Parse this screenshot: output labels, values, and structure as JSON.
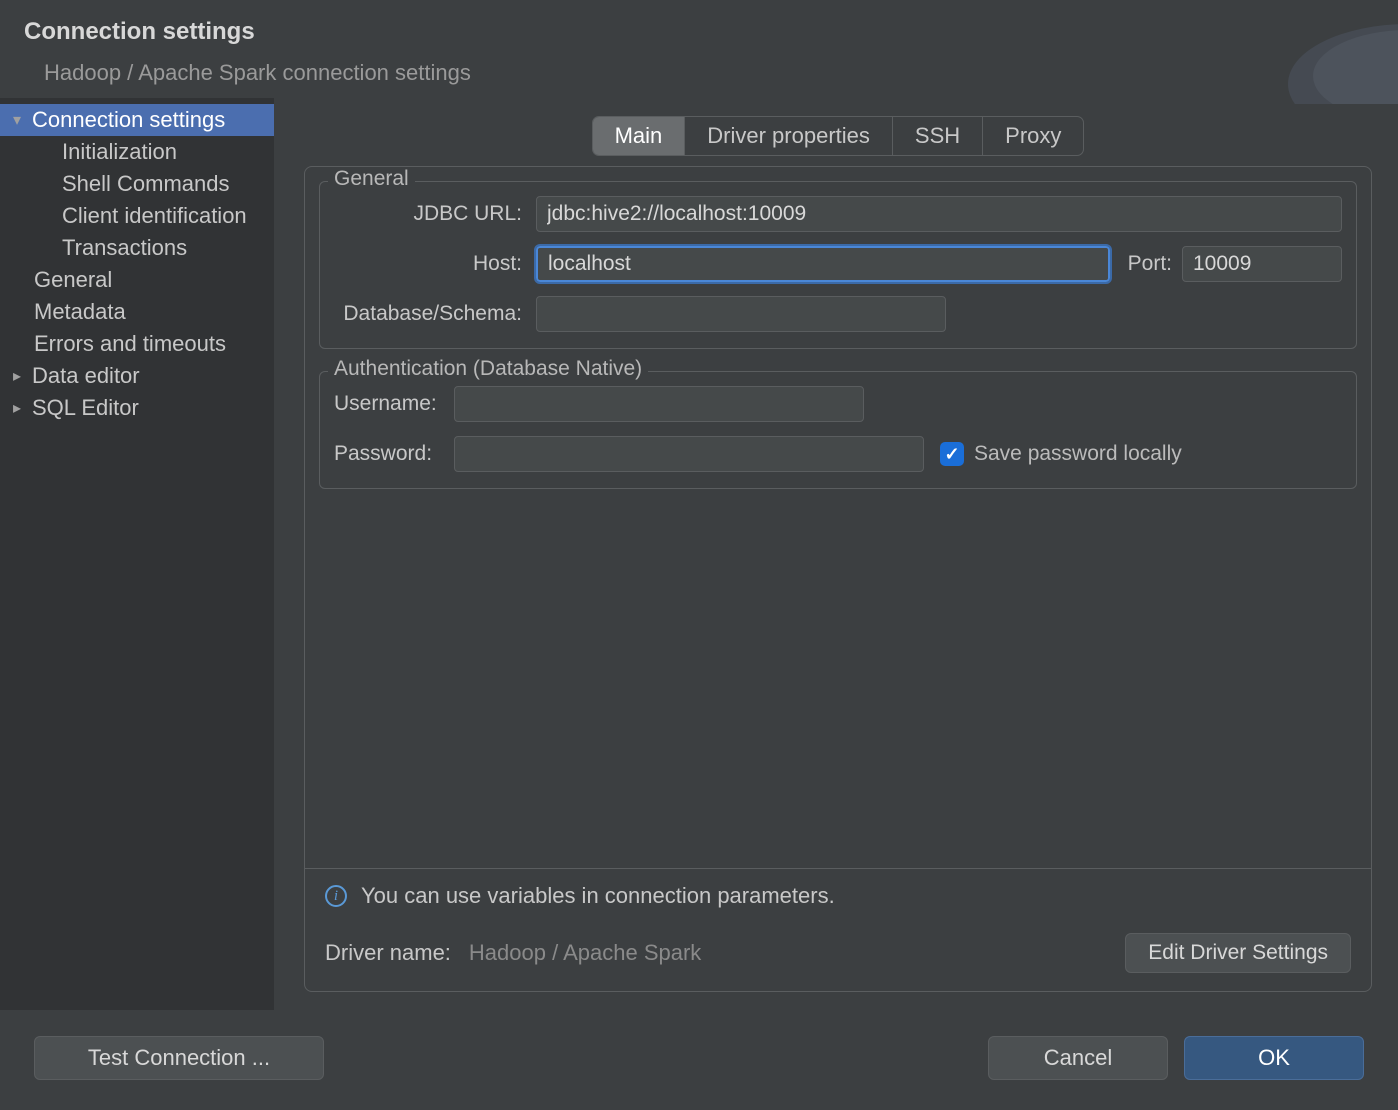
{
  "header": {
    "title": "Connection settings",
    "subtitle": "Hadoop / Apache Spark connection settings"
  },
  "sidebar": {
    "items": [
      {
        "label": "Connection settings",
        "level": 0,
        "expandable": true,
        "open": true,
        "selected": true
      },
      {
        "label": "Initialization",
        "level": 1
      },
      {
        "label": "Shell Commands",
        "level": 1
      },
      {
        "label": "Client identification",
        "level": 1
      },
      {
        "label": "Transactions",
        "level": 1
      },
      {
        "label": "General",
        "level": "0b"
      },
      {
        "label": "Metadata",
        "level": "0b"
      },
      {
        "label": "Errors and timeouts",
        "level": "0b"
      },
      {
        "label": "Data editor",
        "level": 0,
        "expandable": true,
        "open": false
      },
      {
        "label": "SQL Editor",
        "level": 0,
        "expandable": true,
        "open": false
      }
    ]
  },
  "tabs": {
    "main": "Main",
    "driver": "Driver properties",
    "ssh": "SSH",
    "proxy": "Proxy",
    "active": "main"
  },
  "general": {
    "legend": "General",
    "jdbc_label": "JDBC URL:",
    "jdbc_value": "jdbc:hive2://localhost:10009",
    "host_label": "Host:",
    "host_value": "localhost",
    "port_label": "Port:",
    "port_value": "10009",
    "db_label": "Database/Schema:",
    "db_value": ""
  },
  "auth": {
    "legend": "Authentication (Database Native)",
    "user_label": "Username:",
    "user_value": "",
    "pass_label": "Password:",
    "pass_value": "",
    "save_label": "Save password locally",
    "save_checked": true
  },
  "info": {
    "text": "You can use variables in connection parameters."
  },
  "driver": {
    "label": "Driver name:",
    "value": "Hadoop / Apache Spark",
    "edit_btn": "Edit Driver Settings"
  },
  "footer": {
    "test": "Test Connection ...",
    "cancel": "Cancel",
    "ok": "OK"
  }
}
